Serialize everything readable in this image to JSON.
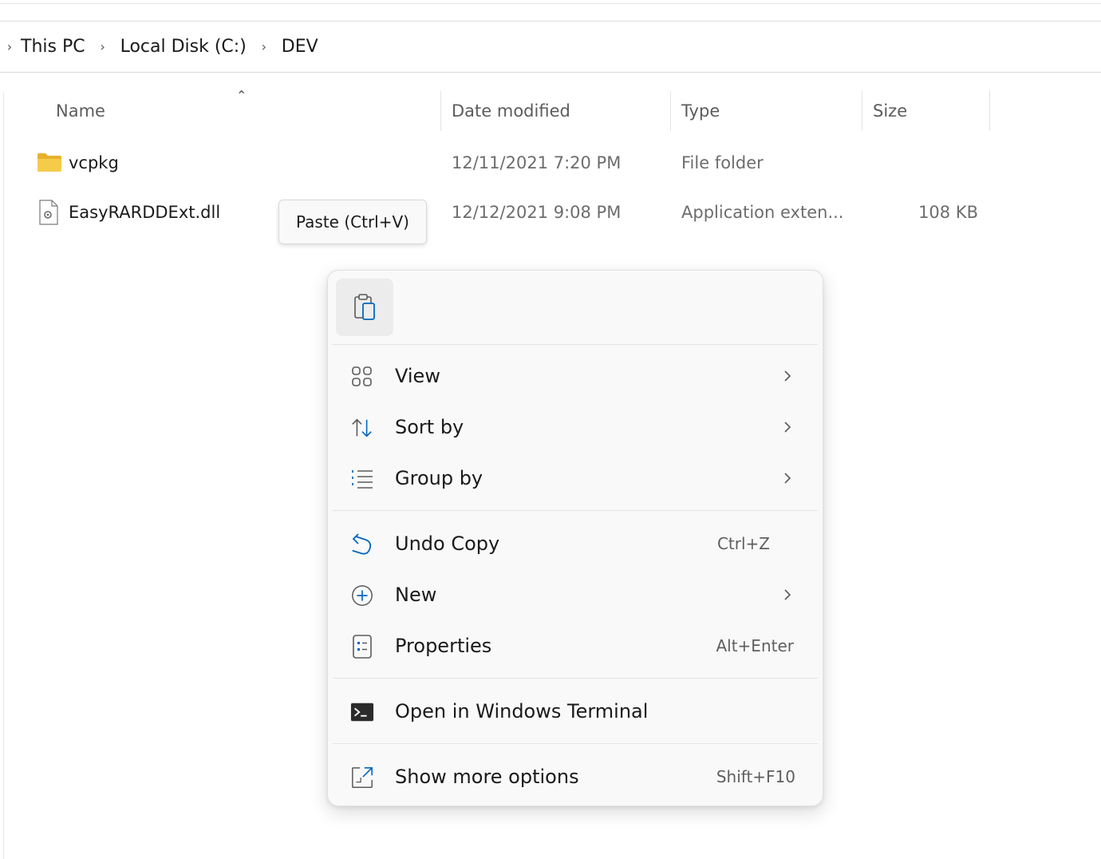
{
  "breadcrumb": {
    "items": [
      "This PC",
      "Local Disk (C:)",
      "DEV"
    ]
  },
  "columns": {
    "name": "Name",
    "date": "Date modified",
    "type": "Type",
    "size": "Size"
  },
  "files": [
    {
      "name": "vcpkg",
      "date": "12/11/2021 7:20 PM",
      "type": "File folder",
      "size": "",
      "icon": "folder-icon"
    },
    {
      "name": "EasyRARDDExt.dll",
      "date": "12/12/2021 9:08 PM",
      "type": "Application exten...",
      "size": "108 KB",
      "icon": "dll-file-icon"
    }
  ],
  "tooltip": {
    "text": "Paste (Ctrl+V)"
  },
  "context_menu": {
    "top_actions": [
      {
        "icon": "paste-icon",
        "tooltip": "Paste (Ctrl+V)"
      }
    ],
    "items": [
      {
        "label": "View",
        "icon": "view-grid-icon",
        "submenu": true
      },
      {
        "label": "Sort by",
        "icon": "sort-icon",
        "submenu": true
      },
      {
        "label": "Group by",
        "icon": "group-list-icon",
        "submenu": true
      },
      {
        "label": "Undo Copy",
        "icon": "undo-icon",
        "shortcut": "Ctrl+Z"
      },
      {
        "label": "New",
        "icon": "add-circle-icon",
        "submenu": true
      },
      {
        "label": "Properties",
        "icon": "properties-icon",
        "shortcut": "Alt+Enter"
      },
      {
        "label": "Open in Windows Terminal",
        "icon": "terminal-icon"
      },
      {
        "label": "Show more options",
        "icon": "more-options-icon",
        "shortcut": "Shift+F10"
      }
    ]
  },
  "colors": {
    "accent": "#0067c0",
    "folder": "#f4c542",
    "menu_bg": "#f9f9f9"
  }
}
